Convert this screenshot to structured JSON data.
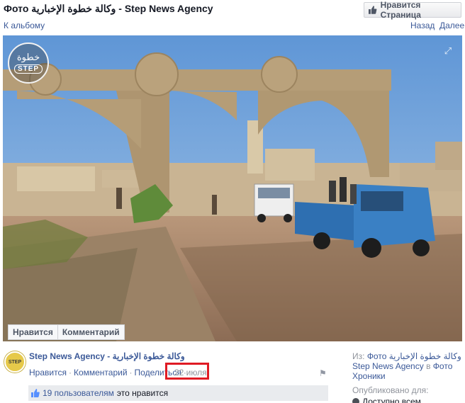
{
  "header": {
    "title": "Фото وكالة خطوة الإخبارية - Step News Agency",
    "like_page_button": "Нравится Страница"
  },
  "nav": {
    "back_to_album": "К альбому",
    "prev": "Назад",
    "next": "Далее"
  },
  "photo": {
    "logo_arabic": "خطوة",
    "logo_text": "STEP",
    "actions": {
      "like": "Нравится",
      "comment": "Комментарий"
    }
  },
  "post": {
    "avatar_text": "STEP",
    "author": "Step News Agency - وكالة خطوة الإخبارية",
    "like": "Нравится",
    "comment": "Комментарий",
    "share": "Поделиться",
    "date": "22 июля",
    "likes_count": "19 пользователям",
    "likes_suffix": "это нравится"
  },
  "sidebar": {
    "from_label": "Из:",
    "from_link": "Фото وكالة خطوة الإخبارية",
    "from_page": "Step News Agency",
    "in_label": "в",
    "album": "Фото Хроники",
    "published_label": "Опубликовано для:",
    "audience": "Доступно всем"
  },
  "colors": {
    "link": "#3b5998",
    "highlight_box": "#e01b24",
    "likes_bar_bg": "#e9ebee"
  }
}
